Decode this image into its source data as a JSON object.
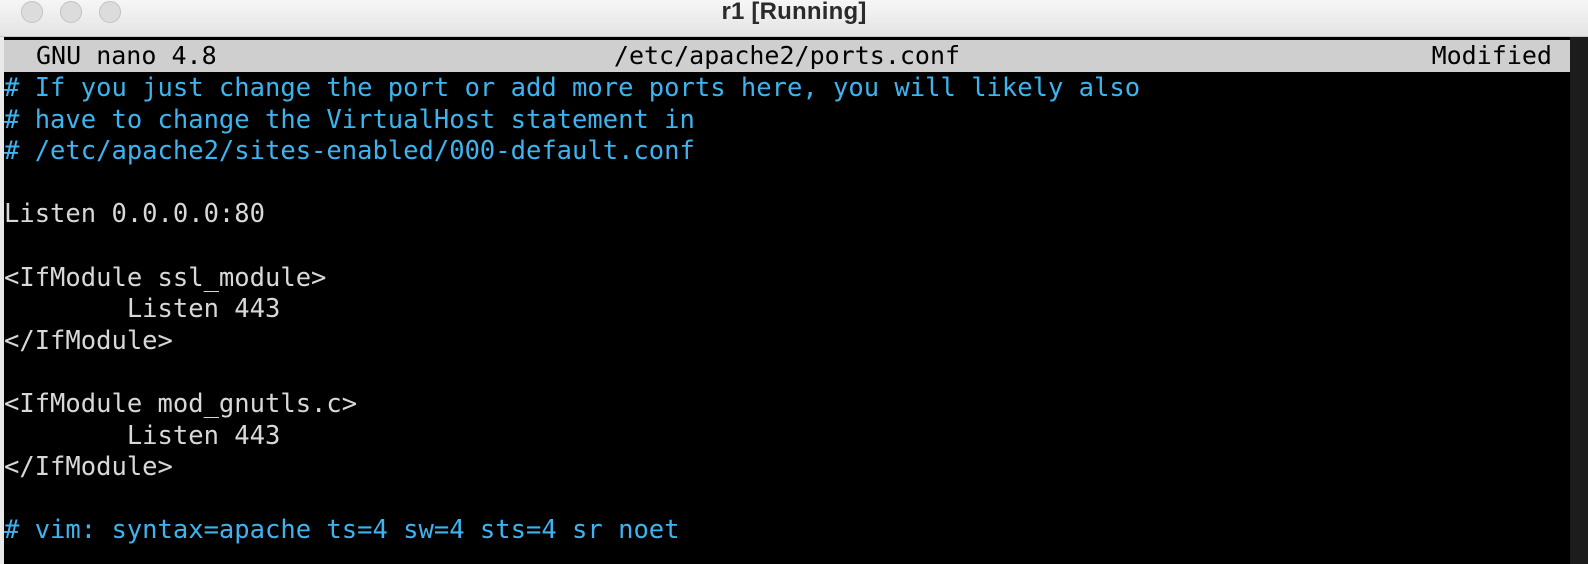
{
  "window": {
    "title": "r1 [Running]"
  },
  "nano": {
    "app_version": "GNU nano 4.8",
    "file_path": "/etc/apache2/ports.conf",
    "status": "Modified"
  },
  "editor": {
    "lines": [
      {
        "text": "# If you just change the port or add more ports here, you will likely also",
        "type": "comment"
      },
      {
        "text": "# have to change the VirtualHost statement in",
        "type": "comment"
      },
      {
        "text": "# /etc/apache2/sites-enabled/000-default.conf",
        "type": "comment"
      },
      {
        "text": "",
        "type": "text"
      },
      {
        "text": "Listen 0.0.0.0:80",
        "type": "text"
      },
      {
        "text": "",
        "type": "text"
      },
      {
        "text": "<IfModule ssl_module>",
        "type": "text"
      },
      {
        "text": "        Listen 443",
        "type": "text"
      },
      {
        "text": "</IfModule>",
        "type": "text"
      },
      {
        "text": "",
        "type": "text"
      },
      {
        "text": "<IfModule mod_gnutls.c>",
        "type": "text"
      },
      {
        "text": "        Listen 443",
        "type": "text"
      },
      {
        "text": "</IfModule>",
        "type": "text"
      },
      {
        "text": "",
        "type": "text"
      },
      {
        "text": "# vim: syntax=apache ts=4 sw=4 sts=4 sr noet",
        "type": "comment"
      }
    ]
  },
  "colors": {
    "comment": "#3db4ef",
    "text": "#d8d8d8",
    "header_bg": "#cfcfcf",
    "background": "#000000"
  }
}
